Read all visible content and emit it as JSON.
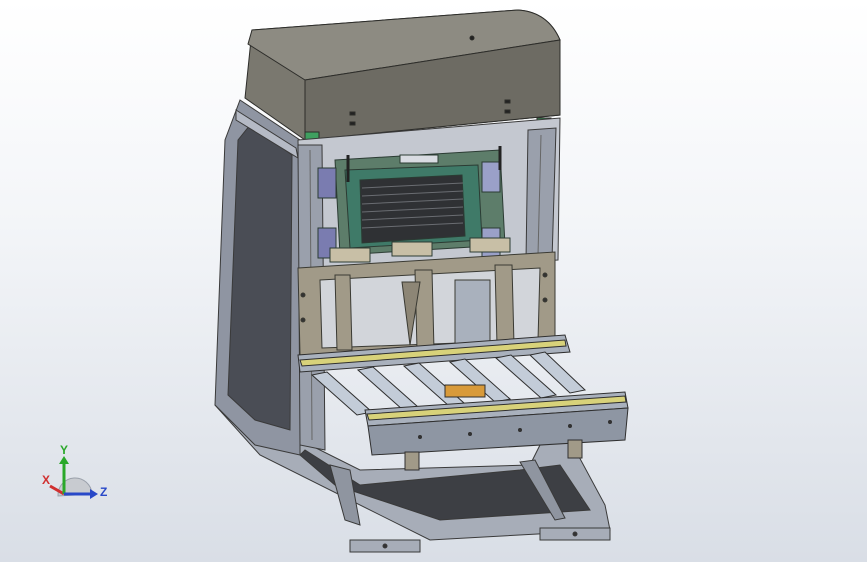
{
  "viewport": {
    "background_top": "#ffffff",
    "background_bottom": "#d9dee6"
  },
  "model": {
    "housing_color": "#77756c",
    "frame_color": "#9ea4b2",
    "panel_color": "#5e6a55",
    "teal_color": "#3f7a68",
    "rail_color": "#d8d27a",
    "roller_color": "#b8c2cf",
    "accent_orange": "#d89a3a"
  },
  "triad": {
    "x_label": "X",
    "y_label": "Y",
    "z_label": "Z",
    "x_color": "#d03030",
    "y_color": "#2aa82a",
    "z_color": "#2848c8"
  }
}
